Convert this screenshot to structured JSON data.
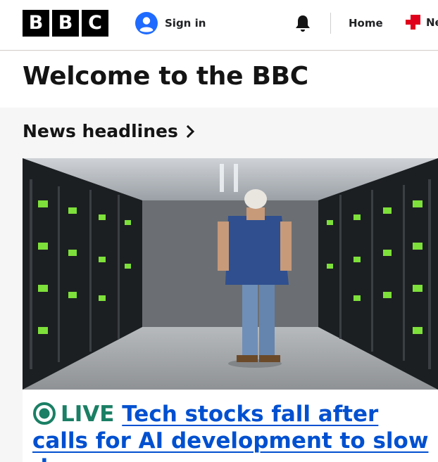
{
  "header": {
    "logo_letters": [
      "B",
      "B",
      "C"
    ],
    "signin_label": "Sign in",
    "signin_icon": "user-avatar-icon",
    "notifications_icon": "bell-icon",
    "nav": [
      {
        "label": "Home"
      },
      {
        "label": "Ne",
        "icon": "bbc-news-icon"
      }
    ]
  },
  "welcome": {
    "title": "Welcome to the BBC"
  },
  "section": {
    "title": "News headlines",
    "chevron_icon": "chevron-right-icon"
  },
  "featured": {
    "image_description": "data centre aisle with server racks",
    "live_icon": "live-indicator-icon",
    "live_label": "LIVE",
    "headline": "Tech stocks fall after calls for AI development to slow down"
  },
  "colors": {
    "accent_blue": "#0050d0",
    "live_green": "#1a7f64",
    "news_red": "#e0001b",
    "logo_black": "#000000"
  }
}
